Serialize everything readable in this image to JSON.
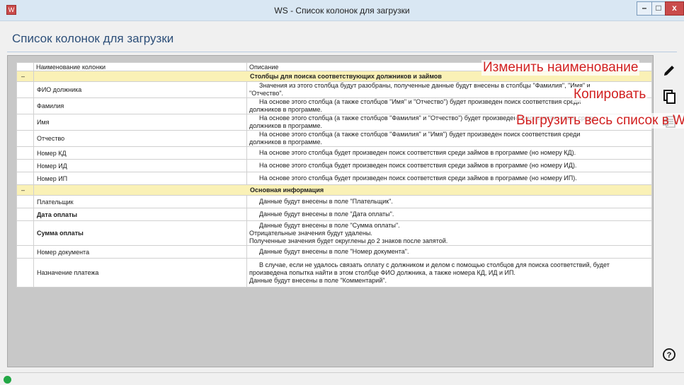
{
  "window": {
    "title": "WS - Список колонок для загрузки",
    "app_icon_glyph": "W",
    "buttons": {
      "minimize": "–",
      "maximize": "□",
      "close": "x"
    }
  },
  "page": {
    "title": "Список колонок для загрузки"
  },
  "table": {
    "headers": {
      "name": "Наименование колонки",
      "description": "Описание"
    },
    "groups": [
      {
        "toggle": "–",
        "title": "Столбцы для поиска соответствующих должников и займов",
        "rows": [
          {
            "name": "ФИО должника",
            "description": [
              "Значения из этого столбца будут разобраны, полученные данные будут внесены в столбцы \"Фамилия\", \"Имя\" и",
              "\"Отчество\"."
            ]
          },
          {
            "name": "Фамилия",
            "description": [
              "На основе этого столбца (а также столбцов \"Имя\" и \"Отчество\") будет произведен поиск соответствия среди",
              "должников в программе."
            ]
          },
          {
            "name": "Имя",
            "description": [
              "На основе этого столбца (а также столбцов \"Фамилия\" и \"Отчество\") будет произведен поиск соответствия среди",
              "должников в программе."
            ]
          },
          {
            "name": "Отчество",
            "description": [
              "На основе этого столбца (а также столбцов \"Фамилия\" и \"Имя\") будет произведен поиск соответствия среди",
              "должников в программе."
            ]
          },
          {
            "name": "Номер КД",
            "description": [
              "На основе этого столбца будет произведен поиск соответствия среди займов в программе (но номеру КД)."
            ]
          },
          {
            "name": "Номер ИД",
            "description": [
              "На основе этого столбца будет произведен поиск соответствия среди займов в программе (но номеру ИД)."
            ]
          },
          {
            "name": "Номер ИП",
            "description": [
              "На основе этого столбца будет произведен поиск соответствия среди займов в программе (но номеру ИП)."
            ]
          }
        ]
      },
      {
        "toggle": "–",
        "title": "Основная информация",
        "rows": [
          {
            "name": "Плательщик",
            "description": [
              "Данные будут внесены в поле \"Плательщик\"."
            ]
          },
          {
            "name": "Дата оплаты",
            "description": [
              "Данные будут внесены в поле \"Дата оплаты\"."
            ]
          },
          {
            "name": "Сумма оплаты",
            "description": [
              "Данные будут внесены в поле \"Сумма оплаты\".",
              "Отрицательные значения будут удалены.",
              "Полученные значения будет округлены до 2 знаков после запятой."
            ]
          },
          {
            "name": "Номер документа",
            "description": [
              "Данные будут внесены в поле \"Номер документа\"."
            ]
          },
          {
            "name": "Назначение платежа",
            "description": [
              "В случае, если не удалось связать оплату с должником и делом с помощью столбцов для поиска соответствий, будет",
              "произведена попытка найти в этом столбце ФИО должника, а также номера КД, ИД и ИП.",
              "Данные будут внесены в поле \"Комментарий\"."
            ]
          }
        ]
      }
    ]
  },
  "toolbar": {
    "edit_icon": "pencil-icon",
    "copy_icon": "copy-icon",
    "word_icon": "word-export-icon",
    "help_icon": "help-icon",
    "help_glyph": "?"
  },
  "callouts": {
    "edit": "Изменить наименование",
    "copy": "Копировать",
    "export": "Выгрузить весь список в Word"
  },
  "colors": {
    "group_row_bg": "#faf1b6",
    "title_text": "#2d4f79",
    "callout_text": "#d11f1f",
    "status_ok": "#22a745"
  }
}
